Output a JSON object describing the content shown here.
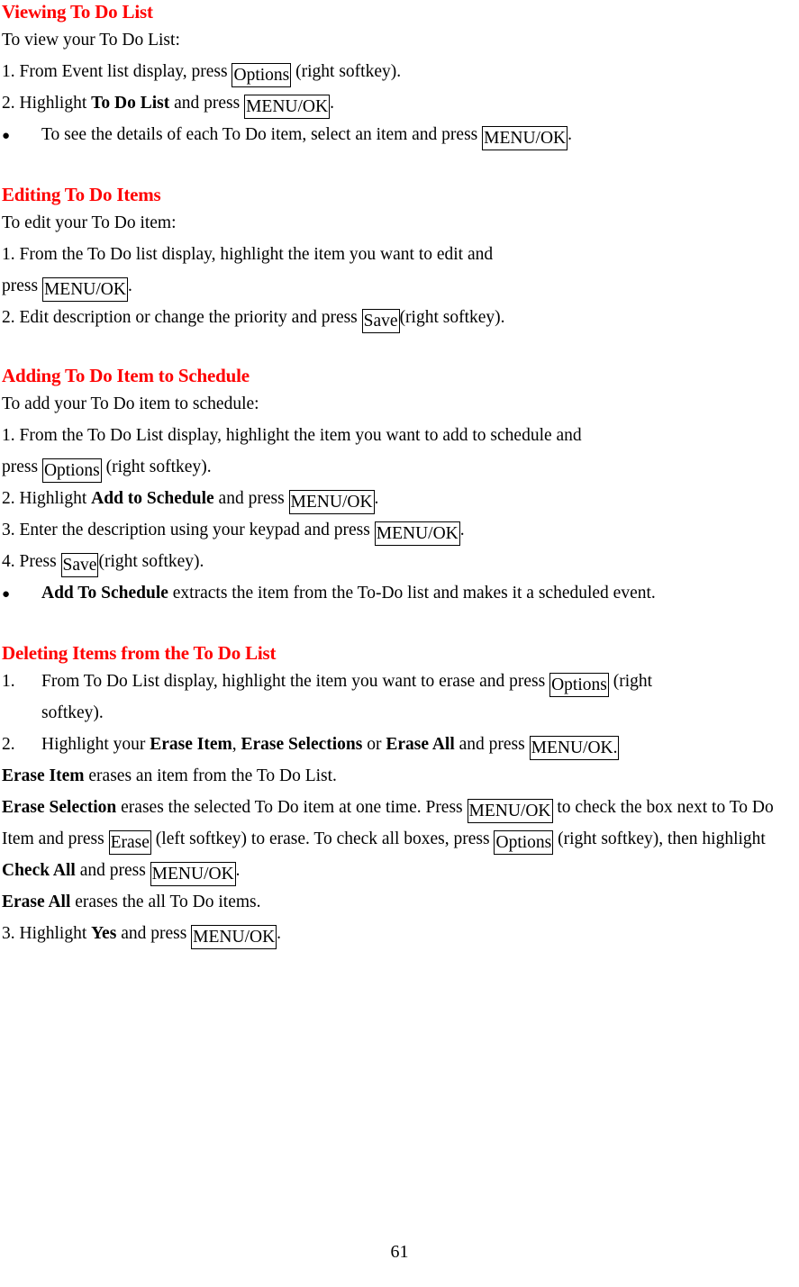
{
  "document": {
    "page_number": "61",
    "heading_color": "#ff0000",
    "body_color": "#000000"
  },
  "sections": [
    {
      "heading": "Viewing To Do List",
      "intro": "To view your To Do List:",
      "steps": [
        {
          "number": "1.",
          "pre": "From Event list display, press ",
          "key": "Options",
          "post": " (right softkey)."
        },
        {
          "number": "2.",
          "pre": "Highlight ",
          "bold": "To Do List",
          "mid": " and press ",
          "key": "MENU/OK",
          "post": "."
        }
      ],
      "bullets": [
        {
          "pre": "To see the details of each To Do item, select an item and press ",
          "key": "MENU/OK",
          "post": "."
        }
      ]
    },
    {
      "heading": "Editing To Do Items",
      "intro": "To edit your To Do item:",
      "steps": [
        {
          "number": "1.",
          "line1": "From the To Do list display, highlight the item you want to edit and",
          "cont_pre": "press ",
          "cont_key": "MENU/OK",
          "cont_post": "."
        },
        {
          "number": "2.",
          "pre": "Edit description or change the priority and press ",
          "key": "Save",
          "post": "(right softkey)."
        }
      ]
    },
    {
      "heading": "Adding To Do Item to Schedule",
      "intro": "To add your To Do item to schedule:",
      "steps": [
        {
          "number": "1.",
          "line1": "From the To Do List display, highlight the item you want to add to schedule and",
          "cont_pre": "press ",
          "cont_key": "Options",
          "cont_post": " (right softkey)."
        },
        {
          "number": "2.",
          "pre": "Highlight ",
          "bold": "Add to Schedule",
          "mid": " and press ",
          "key": "MENU/OK",
          "post": "."
        },
        {
          "number": "3.",
          "pre": "Enter the description using your keypad and press ",
          "key": "MENU/OK",
          "post": "."
        },
        {
          "number": "4.",
          "pre": "Press ",
          "key": "Save",
          "post": "(right softkey)."
        }
      ],
      "bullets": [
        {
          "bold": "Add To Schedule",
          "post": " extracts the item from the To-Do list and makes it a scheduled event."
        }
      ]
    },
    {
      "heading": "Deleting Items from the To Do List",
      "numbered": [
        {
          "number": "1.",
          "pre": "From To Do List display, highlight the item you want to erase and press ",
          "key": "Options",
          "post": " (right",
          "cont": "softkey)."
        },
        {
          "number": "2.",
          "pre": "Highlight your ",
          "bold1": "Erase Item",
          "mid1": ", ",
          "bold2": "Erase Selections",
          "mid2": " or ",
          "bold3": "Erase All",
          "mid3": " and press ",
          "key": "MENU/OK."
        }
      ],
      "definitions": [
        {
          "term": "Erase Item",
          "text": " erases an item from the To Do List."
        },
        {
          "term": "Erase Selection",
          "t1": " erases the selected To Do item at one time. Press ",
          "key1": "MENU/OK",
          "t2": " to check the box next to To Do Item and press ",
          "key2": "Erase",
          "t3": " (left softkey) to erase. To check all boxes, press ",
          "key3": "Options",
          "t4": " (right softkey), then highlight ",
          "bold1": "Check All",
          "t5": " and press ",
          "key4": "MENU/OK",
          "t6": "."
        },
        {
          "term": "Erase All",
          "text": " erases the all To Do items."
        }
      ],
      "final_step": {
        "number": "3.",
        "pre": "Highlight ",
        "bold": "Yes",
        "mid": " and press ",
        "key": "MENU/OK",
        "post": "."
      }
    }
  ]
}
